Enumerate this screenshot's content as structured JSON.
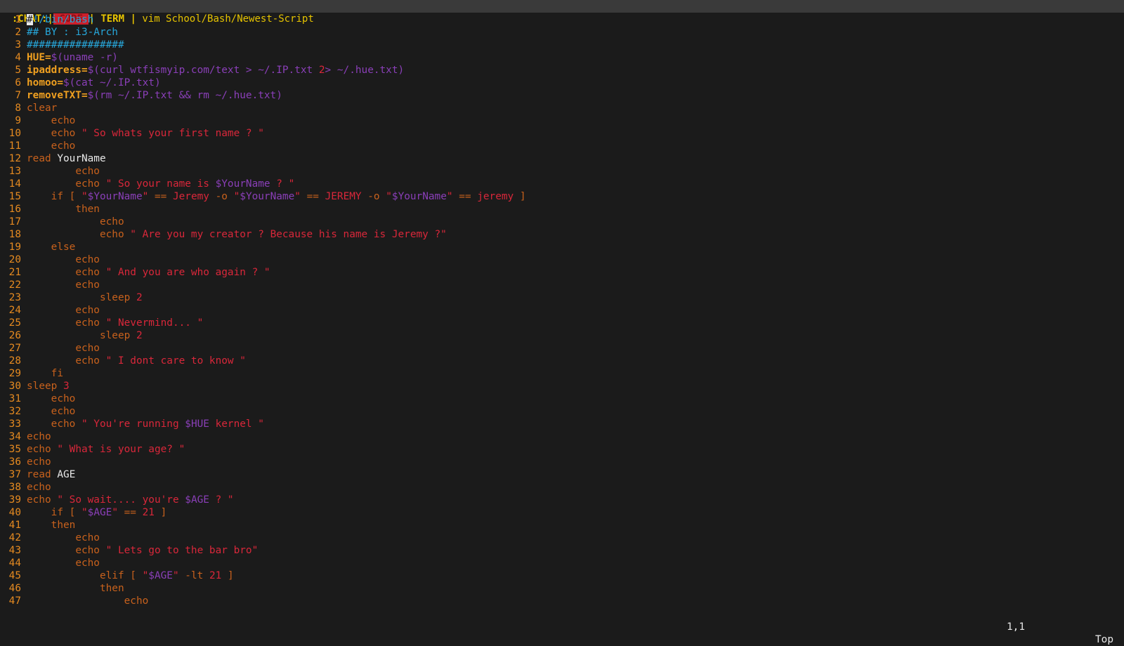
{
  "topbar": {
    "workspace_chat": ":CHAT:",
    "sep1": "|",
    "tab_code": " CODE ",
    "sep2": "|",
    "tab_term": " TERM ",
    "sep3": "|",
    "window_title": " vim School/Bash/Newest-Script"
  },
  "colors": {
    "line_number": "#e58a20",
    "keyword": "#c8611c",
    "string": "#d9273a",
    "variable": "#8a3fb8",
    "comment": "#27a6d9",
    "active_tab_bg": "#cc1f2a"
  },
  "lines": [
    {
      "n": "1",
      "tokens": [
        [
          "cursor",
          "#"
        ],
        [
          "shebang",
          "!/bin/bash"
        ]
      ]
    },
    {
      "n": "2",
      "tokens": [
        [
          "comment",
          "## BY : i3-Arch"
        ]
      ]
    },
    {
      "n": "3",
      "tokens": [
        [
          "comment",
          "################"
        ]
      ]
    },
    {
      "n": "4",
      "tokens": [
        [
          "assign",
          "HUE="
        ],
        [
          "subst",
          "$(uname -r)"
        ]
      ]
    },
    {
      "n": "5",
      "tokens": [
        [
          "assign",
          "ipaddress="
        ],
        [
          "subst",
          "$(curl wtfismyip.com/text > ~/.IP.txt "
        ],
        [
          "num",
          "2"
        ],
        [
          "subst",
          "> ~/.hue.txt)"
        ]
      ]
    },
    {
      "n": "6",
      "tokens": [
        [
          "assign",
          "homoo="
        ],
        [
          "subst",
          "$(cat ~/.IP.txt)"
        ]
      ]
    },
    {
      "n": "7",
      "tokens": [
        [
          "assign",
          "removeTXT="
        ],
        [
          "subst",
          "$(rm ~/.IP.txt && rm ~/.hue.txt)"
        ]
      ]
    },
    {
      "n": "8",
      "tokens": [
        [
          "keyword",
          "clear"
        ]
      ]
    },
    {
      "n": "9",
      "tokens": [
        [
          "default",
          "    "
        ],
        [
          "keyword",
          "echo"
        ]
      ]
    },
    {
      "n": "10",
      "tokens": [
        [
          "default",
          "    "
        ],
        [
          "keyword",
          "echo "
        ],
        [
          "string",
          "\" So whats your first name ? \""
        ]
      ]
    },
    {
      "n": "11",
      "tokens": [
        [
          "default",
          "    "
        ],
        [
          "keyword",
          "echo"
        ]
      ]
    },
    {
      "n": "12",
      "tokens": [
        [
          "keyword",
          "read "
        ],
        [
          "default",
          "YourName"
        ]
      ]
    },
    {
      "n": "13",
      "tokens": [
        [
          "default",
          "        "
        ],
        [
          "keyword",
          "echo"
        ]
      ]
    },
    {
      "n": "14",
      "tokens": [
        [
          "default",
          "        "
        ],
        [
          "keyword",
          "echo "
        ],
        [
          "string",
          "\" So your name is "
        ],
        [
          "var",
          "$YourName"
        ],
        [
          "string",
          " ? \""
        ]
      ]
    },
    {
      "n": "15",
      "tokens": [
        [
          "default",
          "    "
        ],
        [
          "keyword",
          "if [ "
        ],
        [
          "string",
          "\""
        ],
        [
          "var",
          "$YourName"
        ],
        [
          "string",
          "\""
        ],
        [
          "keyword",
          " == "
        ],
        [
          "string",
          "Jeremy"
        ],
        [
          "keyword",
          " -o "
        ],
        [
          "string",
          "\""
        ],
        [
          "var",
          "$YourName"
        ],
        [
          "string",
          "\""
        ],
        [
          "keyword",
          " == "
        ],
        [
          "string",
          "JEREMY"
        ],
        [
          "keyword",
          " -o "
        ],
        [
          "string",
          "\""
        ],
        [
          "var",
          "$YourName"
        ],
        [
          "string",
          "\""
        ],
        [
          "keyword",
          " == "
        ],
        [
          "string",
          "jeremy"
        ],
        [
          "keyword",
          " ]"
        ]
      ]
    },
    {
      "n": "16",
      "tokens": [
        [
          "default",
          "        "
        ],
        [
          "keyword",
          "then"
        ]
      ]
    },
    {
      "n": "17",
      "tokens": [
        [
          "default",
          "            "
        ],
        [
          "keyword",
          "echo"
        ]
      ]
    },
    {
      "n": "18",
      "tokens": [
        [
          "default",
          "            "
        ],
        [
          "keyword",
          "echo "
        ],
        [
          "string",
          "\" Are you my creator ? Because his name is Jeremy ?\""
        ]
      ]
    },
    {
      "n": "19",
      "tokens": [
        [
          "default",
          "    "
        ],
        [
          "keyword",
          "else"
        ]
      ]
    },
    {
      "n": "20",
      "tokens": [
        [
          "default",
          "        "
        ],
        [
          "keyword",
          "echo"
        ]
      ]
    },
    {
      "n": "21",
      "tokens": [
        [
          "default",
          "        "
        ],
        [
          "keyword",
          "echo "
        ],
        [
          "string",
          "\" And you are who again ? \""
        ]
      ]
    },
    {
      "n": "22",
      "tokens": [
        [
          "default",
          "        "
        ],
        [
          "keyword",
          "echo"
        ]
      ]
    },
    {
      "n": "23",
      "tokens": [
        [
          "default",
          "            "
        ],
        [
          "keyword",
          "sleep "
        ],
        [
          "num",
          "2"
        ]
      ]
    },
    {
      "n": "24",
      "tokens": [
        [
          "default",
          "        "
        ],
        [
          "keyword",
          "echo"
        ]
      ]
    },
    {
      "n": "25",
      "tokens": [
        [
          "default",
          "        "
        ],
        [
          "keyword",
          "echo "
        ],
        [
          "string",
          "\" Nevermind... \""
        ]
      ]
    },
    {
      "n": "26",
      "tokens": [
        [
          "default",
          "            "
        ],
        [
          "keyword",
          "sleep "
        ],
        [
          "num",
          "2"
        ]
      ]
    },
    {
      "n": "27",
      "tokens": [
        [
          "default",
          "        "
        ],
        [
          "keyword",
          "echo"
        ]
      ]
    },
    {
      "n": "28",
      "tokens": [
        [
          "default",
          "        "
        ],
        [
          "keyword",
          "echo "
        ],
        [
          "string",
          "\" I dont care to know \""
        ]
      ]
    },
    {
      "n": "29",
      "tokens": [
        [
          "default",
          "    "
        ],
        [
          "keyword",
          "fi"
        ]
      ]
    },
    {
      "n": "30",
      "tokens": [
        [
          "keyword",
          "sleep "
        ],
        [
          "num",
          "3"
        ]
      ]
    },
    {
      "n": "31",
      "tokens": [
        [
          "default",
          "    "
        ],
        [
          "keyword",
          "echo"
        ]
      ]
    },
    {
      "n": "32",
      "tokens": [
        [
          "default",
          "    "
        ],
        [
          "keyword",
          "echo"
        ]
      ]
    },
    {
      "n": "33",
      "tokens": [
        [
          "default",
          "    "
        ],
        [
          "keyword",
          "echo "
        ],
        [
          "string",
          "\" You're running "
        ],
        [
          "var",
          "$HUE"
        ],
        [
          "string",
          " kernel \""
        ]
      ]
    },
    {
      "n": "34",
      "tokens": [
        [
          "keyword",
          "echo"
        ]
      ]
    },
    {
      "n": "35",
      "tokens": [
        [
          "keyword",
          "echo "
        ],
        [
          "string",
          "\" What is your age? \""
        ]
      ]
    },
    {
      "n": "36",
      "tokens": [
        [
          "keyword",
          "echo"
        ]
      ]
    },
    {
      "n": "37",
      "tokens": [
        [
          "keyword",
          "read "
        ],
        [
          "default",
          "AGE"
        ]
      ]
    },
    {
      "n": "38",
      "tokens": [
        [
          "keyword",
          "echo"
        ]
      ]
    },
    {
      "n": "39",
      "tokens": [
        [
          "keyword",
          "echo "
        ],
        [
          "string",
          "\" So wait.... you're "
        ],
        [
          "var",
          "$AGE"
        ],
        [
          "string",
          " ? \""
        ]
      ]
    },
    {
      "n": "40",
      "tokens": [
        [
          "default",
          "    "
        ],
        [
          "keyword",
          "if [ "
        ],
        [
          "string",
          "\""
        ],
        [
          "var",
          "$AGE"
        ],
        [
          "string",
          "\""
        ],
        [
          "keyword",
          " == "
        ],
        [
          "num",
          "21"
        ],
        [
          "keyword",
          " ]"
        ]
      ]
    },
    {
      "n": "41",
      "tokens": [
        [
          "default",
          "    "
        ],
        [
          "keyword",
          "then"
        ]
      ]
    },
    {
      "n": "42",
      "tokens": [
        [
          "default",
          "        "
        ],
        [
          "keyword",
          "echo"
        ]
      ]
    },
    {
      "n": "43",
      "tokens": [
        [
          "default",
          "        "
        ],
        [
          "keyword",
          "echo "
        ],
        [
          "string",
          "\" Lets go to the bar bro\""
        ]
      ]
    },
    {
      "n": "44",
      "tokens": [
        [
          "default",
          "        "
        ],
        [
          "keyword",
          "echo"
        ]
      ]
    },
    {
      "n": "45",
      "tokens": [
        [
          "default",
          "            "
        ],
        [
          "keyword",
          "elif [ "
        ],
        [
          "string",
          "\""
        ],
        [
          "var",
          "$AGE"
        ],
        [
          "string",
          "\""
        ],
        [
          "keyword",
          " -lt "
        ],
        [
          "num",
          "21"
        ],
        [
          "keyword",
          " ]"
        ]
      ]
    },
    {
      "n": "46",
      "tokens": [
        [
          "default",
          "            "
        ],
        [
          "keyword",
          "then"
        ]
      ]
    },
    {
      "n": "47",
      "tokens": [
        [
          "default",
          "                "
        ],
        [
          "keyword",
          "echo"
        ]
      ]
    }
  ],
  "statusline": {
    "cursor_position": "1,1",
    "scroll_position": "Top"
  }
}
